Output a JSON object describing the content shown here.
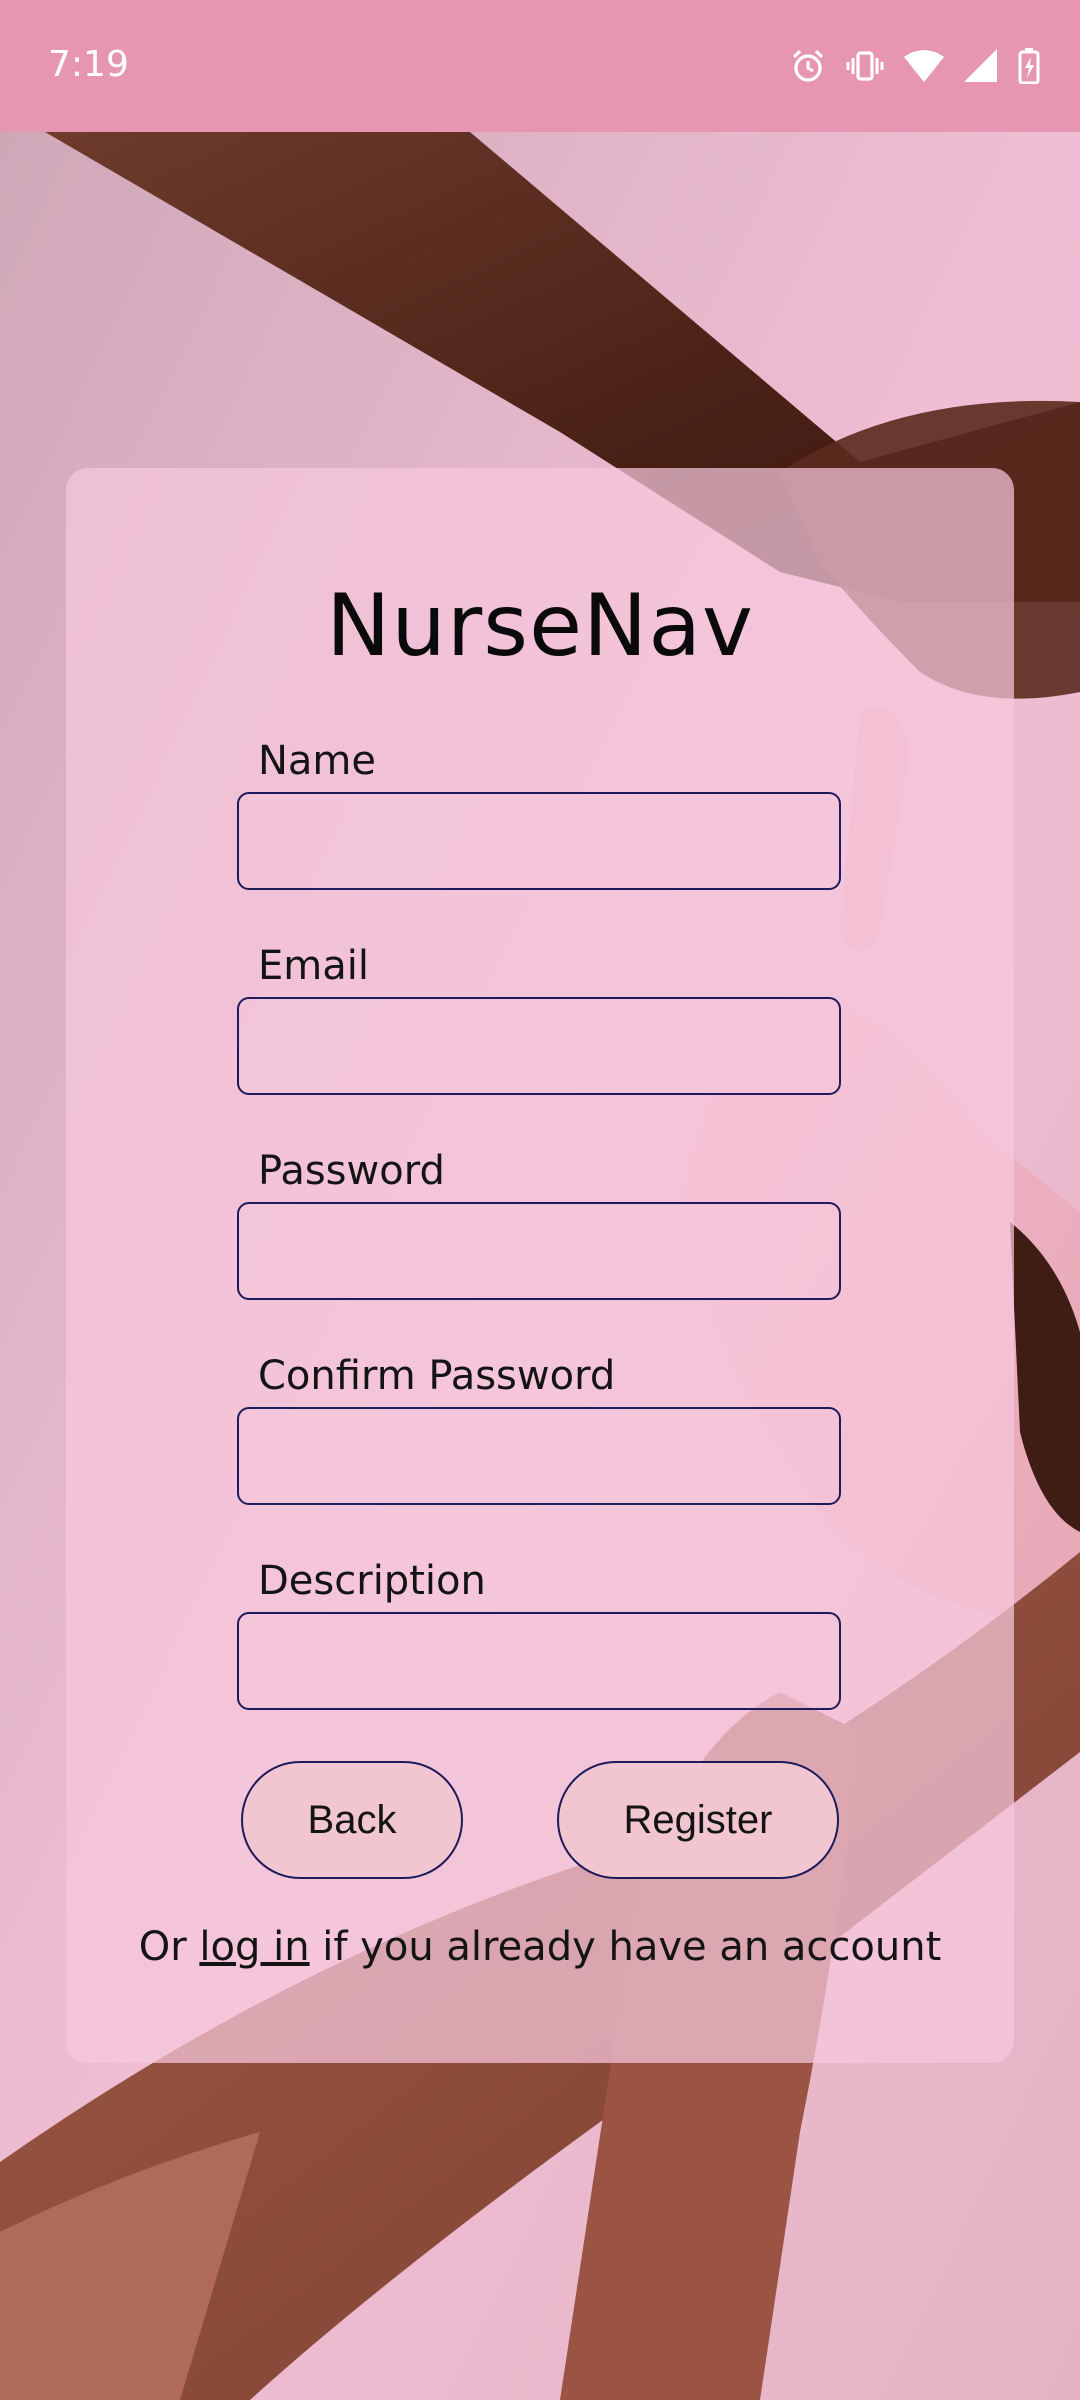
{
  "status_bar": {
    "time": "7:19",
    "icons": [
      "alarm-icon",
      "vibrate-icon",
      "wifi-icon",
      "signal-icon",
      "battery-charging-icon"
    ]
  },
  "app": {
    "title": "NurseNav"
  },
  "form": {
    "name": {
      "label": "Name",
      "value": "",
      "placeholder": ""
    },
    "email": {
      "label": "Email",
      "value": "",
      "placeholder": ""
    },
    "password": {
      "label": "Password",
      "value": "",
      "placeholder": ""
    },
    "confirm_password": {
      "label": "Confirm Password",
      "value": "",
      "placeholder": ""
    },
    "description": {
      "label": "Description",
      "value": "",
      "placeholder": ""
    }
  },
  "buttons": {
    "back": "Back",
    "register": "Register"
  },
  "login_prompt": {
    "prefix": "Or ",
    "link": "log in",
    "suffix": " if you already have an account"
  },
  "colors": {
    "status_bar": "#e796b1",
    "card": "#f7c8dd",
    "input_border": "#1d1b5c",
    "button_fill": "#f2c6d1"
  }
}
